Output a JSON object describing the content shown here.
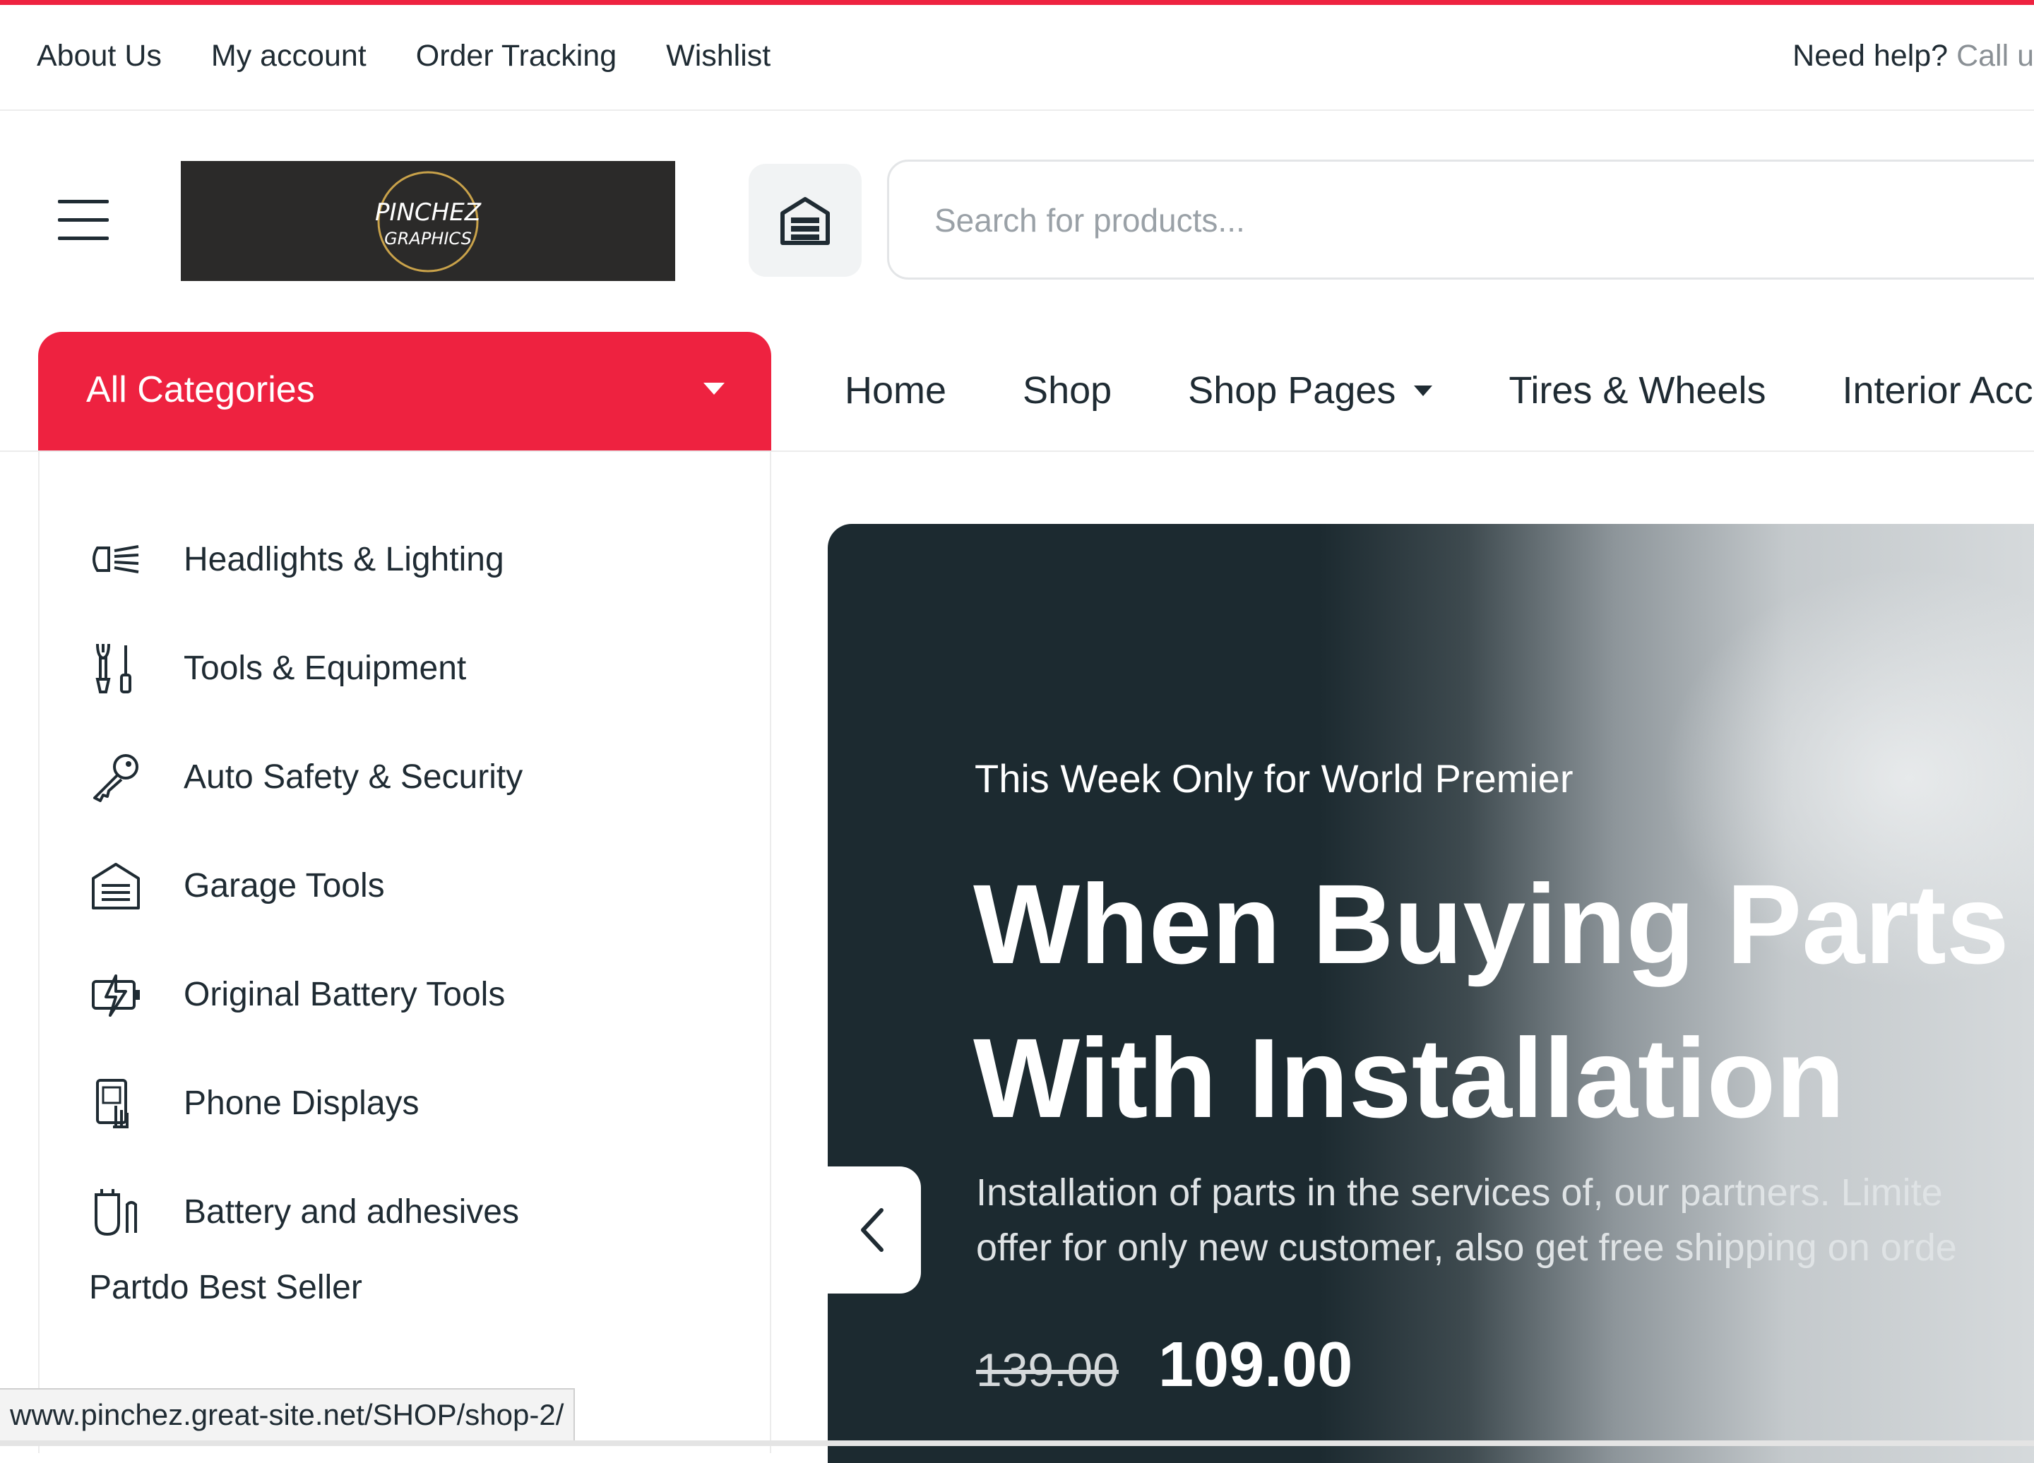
{
  "topbar": {
    "links": [
      "About Us",
      "My account",
      "Order Tracking",
      "Wishlist"
    ],
    "help_label": "Need help?",
    "help_call": "Call u"
  },
  "header": {
    "logo_text_1": "PINCHEZ",
    "logo_text_2": "GRAPHICS",
    "search_placeholder": "Search for products..."
  },
  "categories": {
    "button_label": "All Categories",
    "items": [
      {
        "label": "Headlights & Lighting",
        "icon": "headlight-icon"
      },
      {
        "label": "Tools & Equipment",
        "icon": "tools-icon"
      },
      {
        "label": "Auto Safety & Security",
        "icon": "key-icon"
      },
      {
        "label": "Garage Tools",
        "icon": "garage-icon"
      },
      {
        "label": "Original Battery Tools",
        "icon": "battery-icon"
      },
      {
        "label": "Phone Displays",
        "icon": "phone-display-icon"
      },
      {
        "label": "Battery and adhesives",
        "icon": "adhesive-icon"
      }
    ],
    "best_seller": "Partdo Best Seller"
  },
  "nav": {
    "items": [
      "Home",
      "Shop",
      "Shop Pages",
      "Tires & Wheels",
      "Interior Acc"
    ]
  },
  "hero": {
    "eyebrow": "This Week Only for World Premier",
    "title_line1": "When Buying Parts",
    "title_line2": "With Installation",
    "desc_line1": "Installation of parts in the services of, our partners. Limite",
    "desc_line2": "offer for only new customer, also get free shipping on orde",
    "old_price": "139.00",
    "new_price": "109.00"
  },
  "status_url": "www.pinchez.great-site.net/SHOP/shop-2/",
  "colors": {
    "accent": "#ee2240",
    "hero_dark": "#1c2a30",
    "text": "#1f2b33"
  }
}
